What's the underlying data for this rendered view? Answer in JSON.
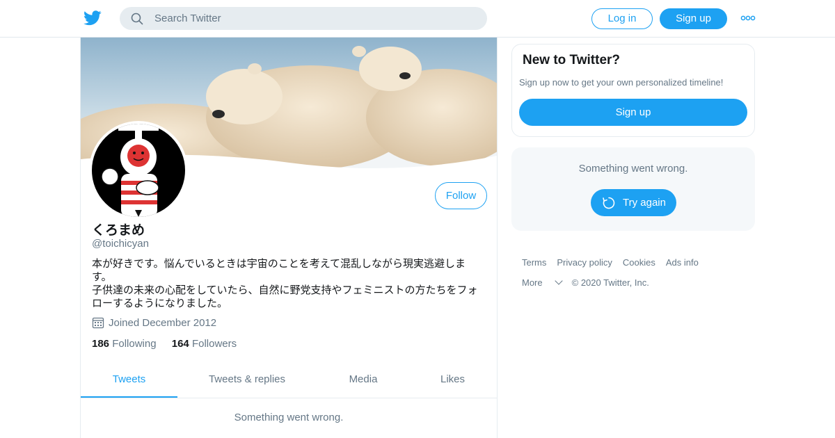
{
  "header": {
    "search_placeholder": "Search Twitter",
    "login_label": "Log in",
    "signup_label": "Sign up",
    "icons": {
      "logo": "twitter-bird-icon",
      "search": "search-icon",
      "more": "more-dots-icon"
    }
  },
  "profile": {
    "follow_label": "Follow",
    "name": "くろまめ",
    "handle": "@toichicyan",
    "bio_lines": [
      "本が好きです。悩んでいるときは宇宙のことを考えて混乱しながら現実逃避しま",
      "す。",
      "子供達の未来の心配をしていたら、自然に野党支持やフェミニストの方たちをフォ",
      "ローするようになりました。"
    ],
    "joined": "Joined December 2012",
    "following_count": "186",
    "following_label": "Following",
    "followers_count": "164",
    "followers_label": "Followers"
  },
  "tabs": [
    {
      "label": "Tweets"
    },
    {
      "label": "Tweets & replies"
    },
    {
      "label": "Media"
    },
    {
      "label": "Likes"
    }
  ],
  "main_error": "Something went wrong.",
  "sidebar": {
    "new_title": "New to Twitter?",
    "new_subtitle": "Sign up now to get your own personalized timeline!",
    "signup_label": "Sign up",
    "error_text": "Something went wrong.",
    "try_again_label": "Try again"
  },
  "footer": {
    "terms": "Terms",
    "privacy": "Privacy policy",
    "cookies": "Cookies",
    "ads": "Ads info",
    "more": "More",
    "copyright": "© 2020 Twitter, Inc."
  },
  "colors": {
    "accent": "#1da1f2",
    "secondary_text": "#657786",
    "border": "#e6ecf0",
    "search_bg": "#e6ecf0",
    "panel_bg": "#f5f8fa"
  }
}
